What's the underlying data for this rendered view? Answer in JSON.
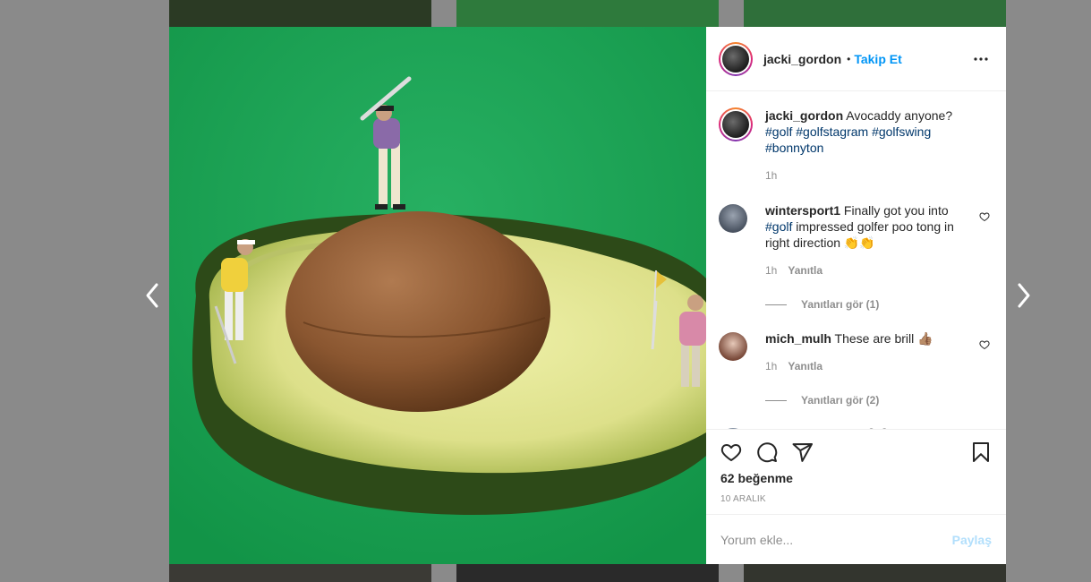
{
  "post": {
    "username": "jacki_gordon",
    "follow_label": "Takip Et",
    "dot": "•",
    "likes": "62 beğenme",
    "date": "10 ARALIK"
  },
  "caption": {
    "username": "jacki_gordon",
    "text": "Avocaddy anyone?",
    "tags": [
      "#golf",
      "#golfstagram",
      "#golfswing",
      "#bonnyton"
    ],
    "time": "1h"
  },
  "comments": [
    {
      "username": "wintersport1",
      "text_before": "Finally got you into",
      "tag": "#golf",
      "text_after": "impressed golfer poo tong in right direction 👏👏",
      "time": "1h",
      "reply_label": "Yanıtla",
      "view_replies": "Yanıtları gör (1)"
    },
    {
      "username": "mich_mulh",
      "text": "These are brill 👍🏽",
      "time": "1h",
      "reply_label": "Yanıtla",
      "view_replies": "Yanıtları gör (2)"
    },
    {
      "username": "gaynorspetpack",
      "text": "😆😆"
    }
  ],
  "add_comment": {
    "placeholder": "Yorum ekle...",
    "post_label": "Paylaş"
  },
  "colors": {
    "follow": "#0095f6",
    "hashtag": "#00376b",
    "post_disabled": "#b2dffc",
    "photo_background": "#1fa355"
  },
  "icons": {
    "prev": "chevron-left-icon",
    "next": "chevron-right-icon",
    "more": "more-horizontal-icon",
    "like": "heart-icon",
    "comment": "comment-icon",
    "share": "paper-plane-icon",
    "save": "bookmark-icon"
  }
}
